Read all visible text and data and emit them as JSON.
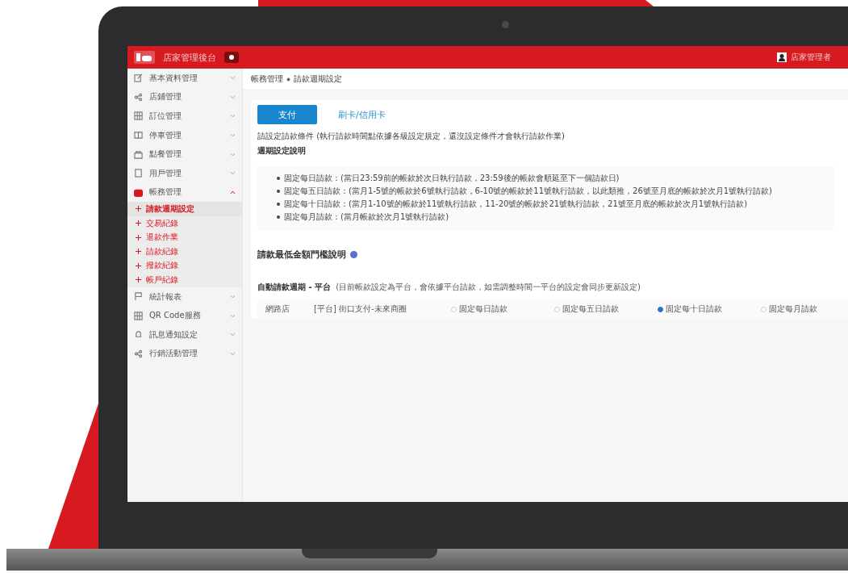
{
  "header": {
    "title": "店家管理後台",
    "user": "店家管理者"
  },
  "sidebar": {
    "items": [
      {
        "label": "基本資料管理",
        "expanded": false
      },
      {
        "label": "店鋪管理",
        "expanded": false
      },
      {
        "label": "訂位管理",
        "expanded": false
      },
      {
        "label": "停車管理",
        "expanded": false
      },
      {
        "label": "點餐管理",
        "expanded": false
      },
      {
        "label": "用戶管理",
        "expanded": false
      },
      {
        "label": "帳務管理",
        "expanded": true,
        "children": [
          {
            "label": "請款週期設定",
            "selected": true
          },
          {
            "label": "交易紀錄",
            "selected": false
          },
          {
            "label": "退款作業",
            "selected": false
          },
          {
            "label": "請款紀錄",
            "selected": false
          },
          {
            "label": "撥款紀錄",
            "selected": false
          },
          {
            "label": "帳戶紀錄",
            "selected": false
          }
        ]
      },
      {
        "label": "統計報表",
        "expanded": false
      },
      {
        "label": "QR Code服務",
        "expanded": false
      },
      {
        "label": "訊息通知設定",
        "expanded": false
      },
      {
        "label": "行銷活動管理",
        "expanded": false
      }
    ]
  },
  "breadcrumb": [
    "帳務管理",
    "請款週期設定"
  ],
  "tabs": [
    {
      "label": "支付",
      "selected": true
    },
    {
      "label": "刷卡/信用卡",
      "selected": false
    }
  ],
  "intro": "請設定請款條件 (執行請款時間點依據各級設定規定，還沒設定條件才會執行請款作業)",
  "cycle_heading": "週期設定說明",
  "cycle_notes": [
    "固定每日請款：(當日23:59前的帳款於次日執行請款，23:59後的帳款會順延至下一個請款日)",
    "固定每五日請款：(當月1-5號的帳款於6號執行請款，6-10號的帳款於11號執行請款，以此類推，26號至月底的帳款於次月1號執行請款)",
    "固定每十日請款：(當月1-10號的帳款於11號執行請款，11-20號的帳款於21號執行請款，21號至月底的帳款於次月1號執行請款)",
    "固定每月請款：(當月帳款於次月1號執行請款)"
  ],
  "threshold_heading": "請款最低金額門檻說明",
  "auto_heading": "自動請款週期 - 平台",
  "auto_note": "(目前帳款設定為平台，會依據平台請款，如需調整時間一平台的設定會同步更新設定)",
  "row": {
    "store": "網路店",
    "platform": "[平台] 街口支付-未來商圈",
    "options": [
      {
        "label": "固定每日請款",
        "selected": false
      },
      {
        "label": "固定每五日請款",
        "selected": false
      },
      {
        "label": "固定每十日請款",
        "selected": true
      },
      {
        "label": "固定每月請款",
        "selected": false
      }
    ]
  }
}
